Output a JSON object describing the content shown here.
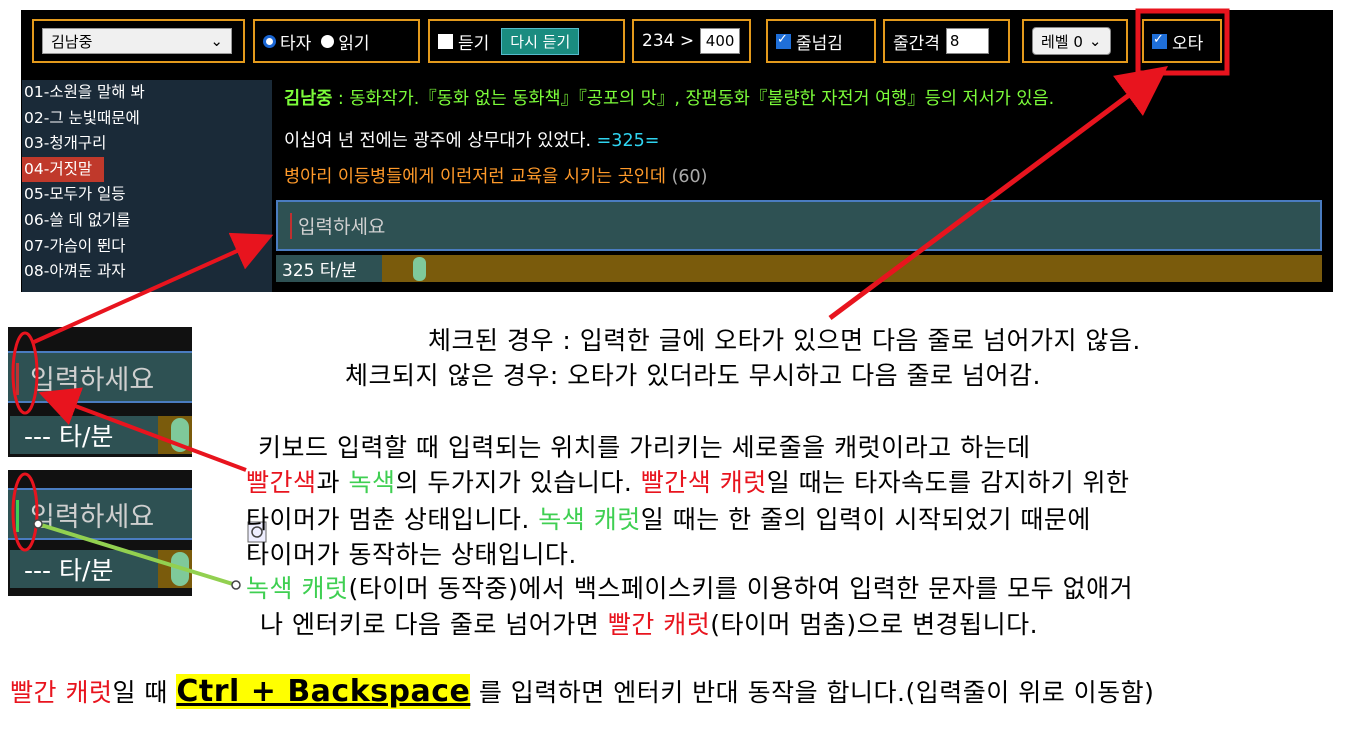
{
  "toolbar": {
    "user_select": "김남중",
    "radio_typing": "타자",
    "radio_reading": "읽기",
    "listen_label": "듣기",
    "relisten_button": "다시 듣기",
    "progress_current": "234 >",
    "progress_target": "400",
    "line_skip_label": "줄넘김",
    "line_spacing_label": "줄간격",
    "line_spacing_value": "8",
    "level_select": "레벨 0",
    "typo_label": "오타"
  },
  "sidebar": {
    "items": [
      {
        "label": "01-소원을 말해 봐"
      },
      {
        "label": "02-그 눈빛때문에"
      },
      {
        "label": "03-청개구리"
      },
      {
        "label": "04-거짓말"
      },
      {
        "label": "05-모두가 일등"
      },
      {
        "label": "06-쓸 데 없기를"
      },
      {
        "label": "07-가슴이 뛴다"
      },
      {
        "label": "08-아껴둔 과자"
      }
    ],
    "active_index": 3
  },
  "panel": {
    "author_name": "김남중",
    "author_desc": " : 동화작가.『동화 없는 동화책』『공포의 맛』, 장편동화『불량한 자전거 여행』등의 저서가 있음.",
    "line1": "이십여 년 전에는 광주에 상무대가 있었다.",
    "line1_count": " =325=",
    "line2": "병아리 이등병들에게 이런저런 교육을 시키는 곳인데",
    "line2_count": " (60)",
    "input_placeholder": "입력하세요",
    "speed_label": "325 타/분"
  },
  "crops": {
    "input_placeholder": "입력하세요",
    "speed_label": "--- 타/분"
  },
  "notes": {
    "checked": "체크된 경우 :  입력한 글에 오타가 있으면 다음 줄로 넘어가지 않음.",
    "unchecked": "체크되지 않은 경우: 오타가 있더라도 무시하고 다음 줄로 넘어감.",
    "p1_line1": "키보드 입력할 때 입력되는 위치를 가리키는 세로줄을 캐럿이라고 하는데",
    "p1_red1": "빨간색",
    "p1_t1": "과 ",
    "p1_green1": "녹색",
    "p1_t2": "의 두가지가 있습니다. ",
    "p1_red2": "빨간색 캐럿",
    "p1_t3": "일 때는 타자속도를 감지하기 위한",
    "p1_line3a": "타이머가 멈춘 상태입니다.  ",
    "p1_green2": "녹색 캐럿",
    "p1_line3b": "일 때는 한 줄의 입력이 시작되었기 때문에",
    "p1_line4": "타이머가 동작하는 상태입니다.",
    "p2_green": "녹색 캐럿",
    "p2_t1": "(타이머 동작중)에서 백스페이스키를 이용하여 입력한 문자를 모두 없애거",
    "p2_t2": "나 엔터키로 다음 줄로 넘어가면 ",
    "p2_red": "빨간 캐럿",
    "p2_t3": "(타이머 멈춤)으로 변경됩니다.",
    "bottom_red": "빨간 캐럿",
    "bottom_t1": "일 때 ",
    "bottom_key": "Ctrl + Backspace",
    "bottom_t2": " 를 입력하면 엔터키 반대 동작을 합니다.(입력줄이 위로 이동함)"
  },
  "colors": {
    "accent_orange": "#e39a1c",
    "annotation_red": "#e8141e",
    "caret_green": "#3fcf52",
    "input_bg": "#2e5153",
    "highlight_yellow": "#ffff00"
  }
}
